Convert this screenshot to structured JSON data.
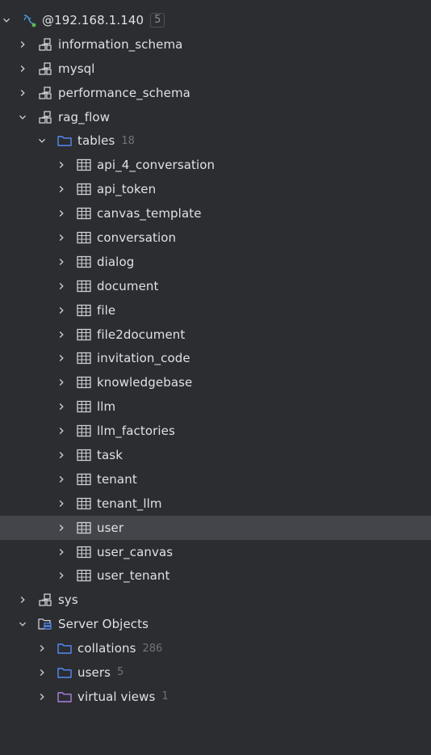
{
  "connection": {
    "label": "@192.168.1.140",
    "badge": "5",
    "icon": "mysql-dolphin-icon"
  },
  "schemas": [
    {
      "label": "information_schema"
    },
    {
      "label": "mysql"
    },
    {
      "label": "performance_schema"
    },
    {
      "label": "rag_flow"
    }
  ],
  "tables_folder": {
    "label": "tables",
    "count": "18"
  },
  "tables": [
    "api_4_conversation",
    "api_token",
    "canvas_template",
    "conversation",
    "dialog",
    "document",
    "file",
    "file2document",
    "invitation_code",
    "knowledgebase",
    "llm",
    "llm_factories",
    "task",
    "tenant",
    "tenant_llm",
    "user",
    "user_canvas",
    "user_tenant"
  ],
  "selected_table": "user",
  "sys_schema": {
    "label": "sys"
  },
  "server_objects": {
    "label": "Server Objects",
    "items": [
      {
        "label": "collations",
        "count": "286",
        "color": "#548af7"
      },
      {
        "label": "users",
        "count": "5",
        "color": "#548af7"
      },
      {
        "label": "virtual views",
        "count": "1",
        "color": "#b07fe0"
      }
    ]
  },
  "colors": {
    "background": "#2b2d30",
    "selection": "#43454a",
    "folder_blue": "#548af7",
    "folder_purple": "#b07fe0",
    "icon_gray": "#ced0d6",
    "count_gray": "#6f737a"
  }
}
